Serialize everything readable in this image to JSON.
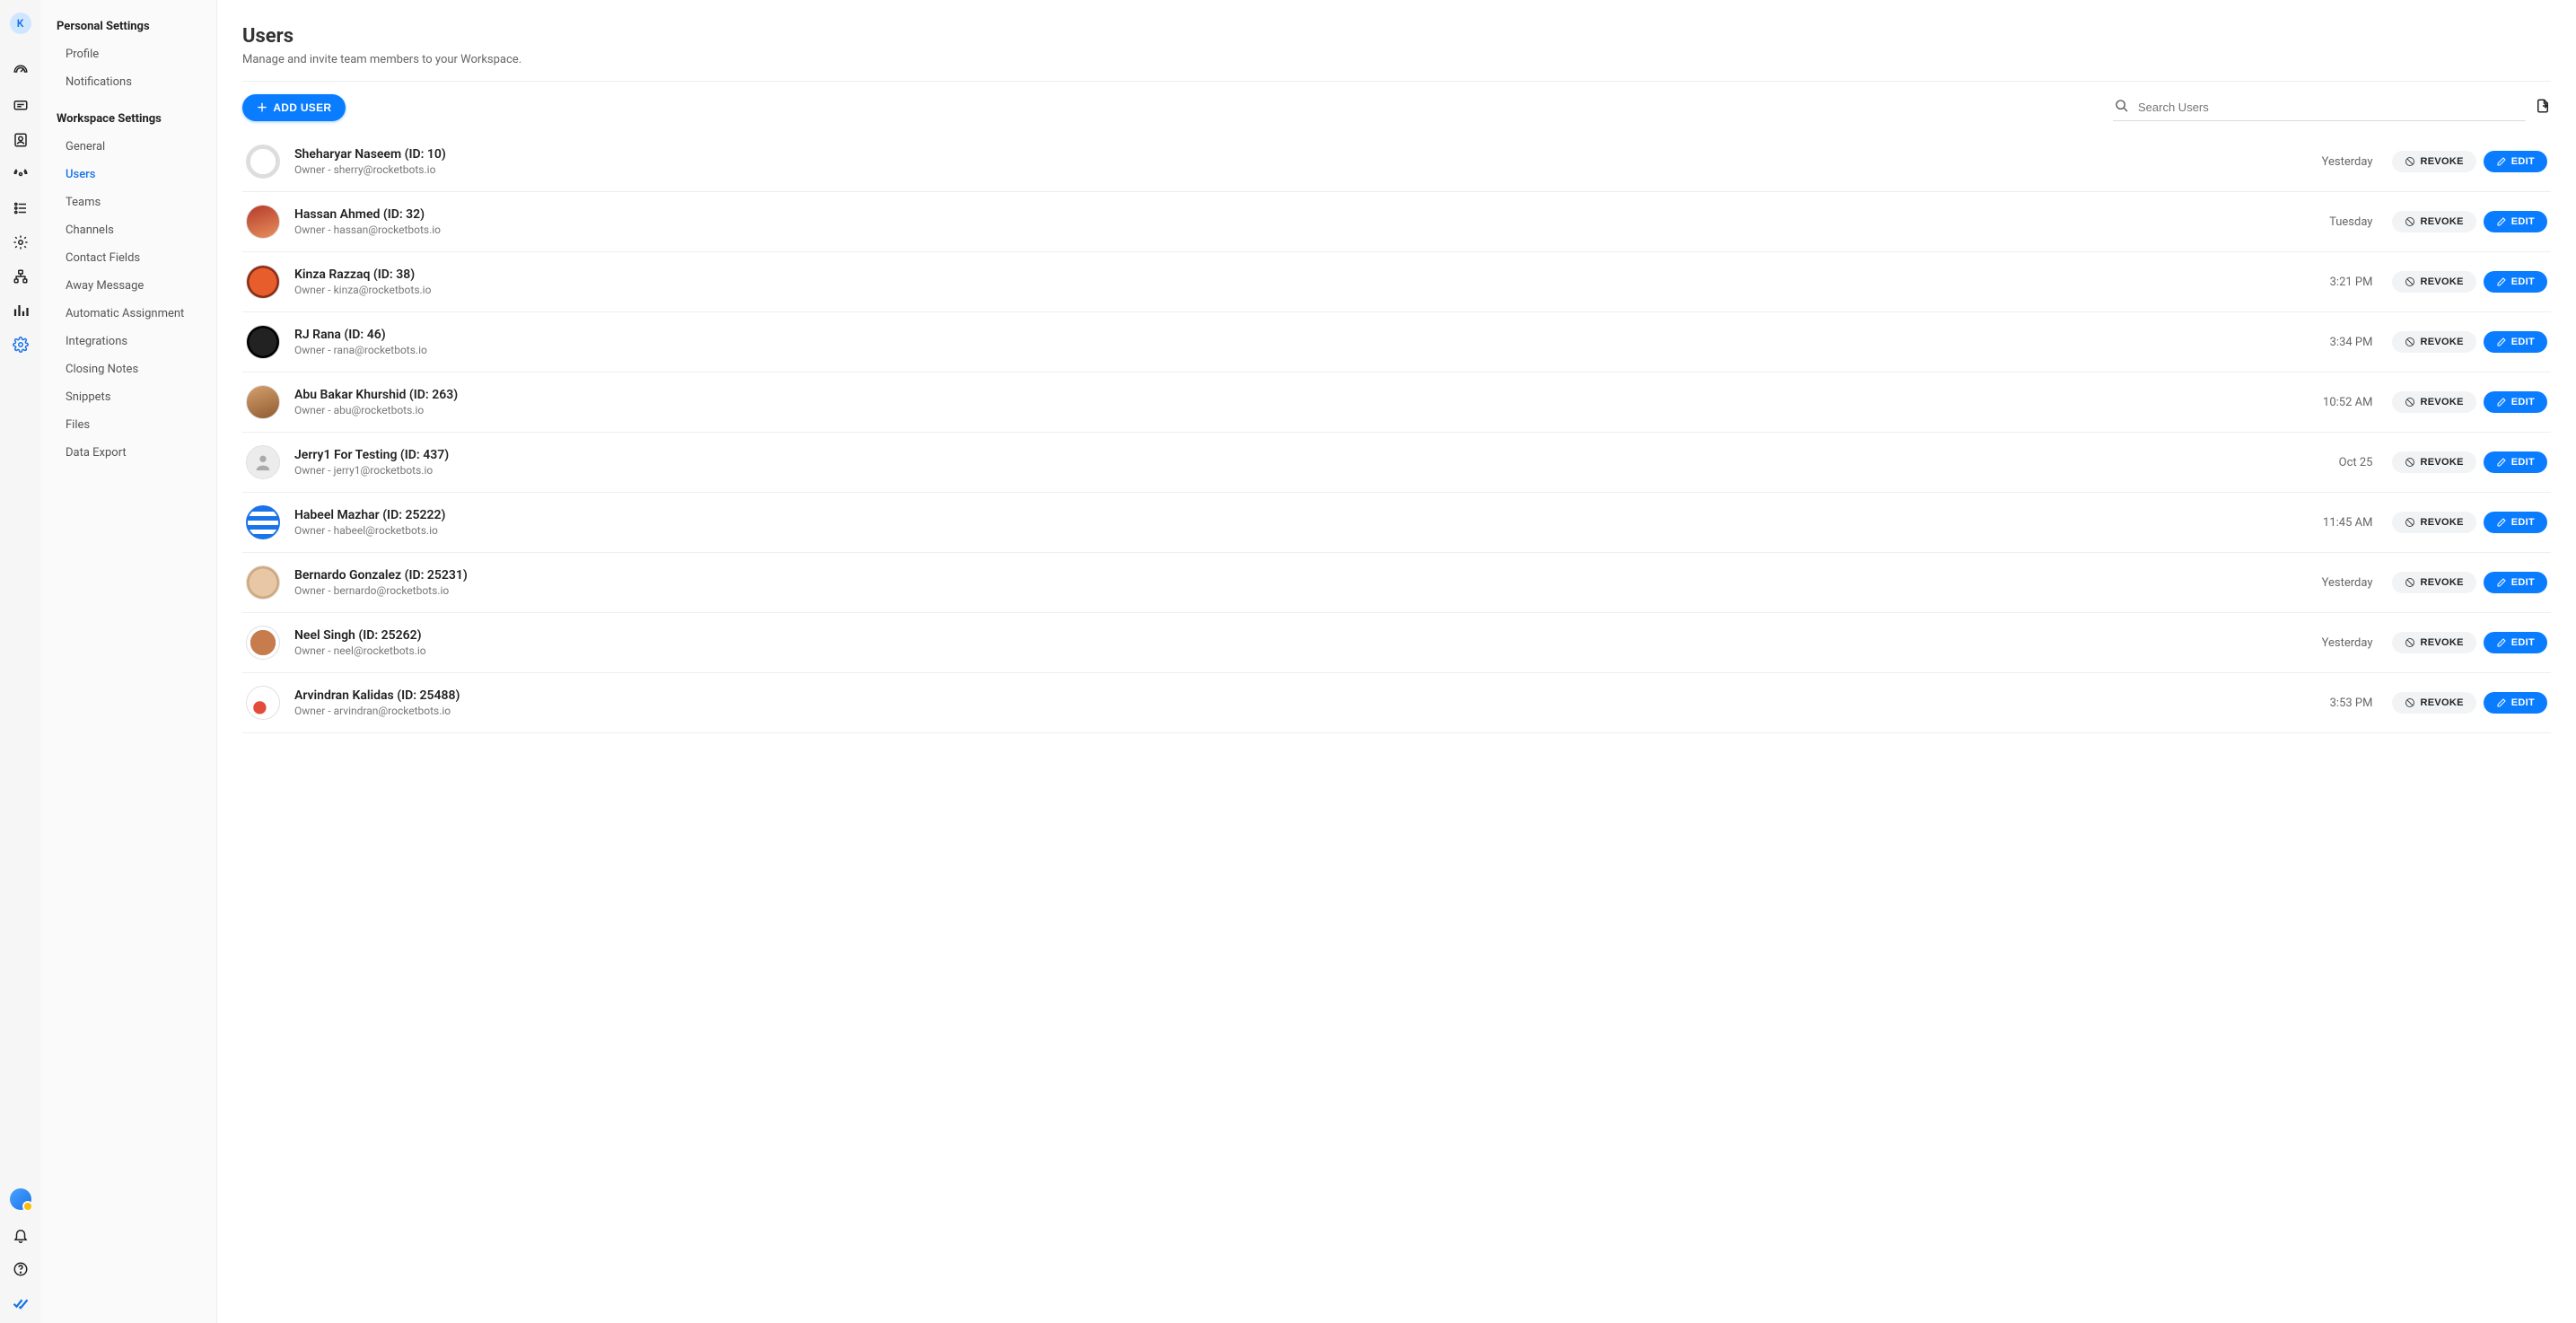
{
  "avatar_letter": "K",
  "settings_sidebar": {
    "group1_title": "Personal Settings",
    "group1_items": [
      "Profile",
      "Notifications"
    ],
    "group2_title": "Workspace Settings",
    "group2_items": [
      "General",
      "Users",
      "Teams",
      "Channels",
      "Contact Fields",
      "Away Message",
      "Automatic Assignment",
      "Integrations",
      "Closing Notes",
      "Snippets",
      "Files",
      "Data Export"
    ],
    "active_item": "Users"
  },
  "page": {
    "title": "Users",
    "subtitle": "Manage and invite team members to your Workspace."
  },
  "toolbar": {
    "add_label": "ADD USER",
    "search_placeholder": "Search Users"
  },
  "actions": {
    "revoke_label": "REVOKE",
    "edit_label": "EDIT"
  },
  "users": [
    {
      "name": "Sheharyar Naseem (ID: 10)",
      "meta": "Owner - sherry@rocketbots.io",
      "time": "Yesterday",
      "avatar_cls": "av-a"
    },
    {
      "name": "Hassan Ahmed (ID: 32)",
      "meta": "Owner - hassan@rocketbots.io",
      "time": "Tuesday",
      "avatar_cls": "av-b"
    },
    {
      "name": "Kinza Razzaq (ID: 38)",
      "meta": "Owner - kinza@rocketbots.io",
      "time": "3:21 PM",
      "avatar_cls": "av-c"
    },
    {
      "name": "RJ Rana (ID: 46)",
      "meta": "Owner - rana@rocketbots.io",
      "time": "3:34 PM",
      "avatar_cls": "av-d"
    },
    {
      "name": "Abu Bakar Khurshid (ID: 263)",
      "meta": "Owner - abu@rocketbots.io",
      "time": "10:52 AM",
      "avatar_cls": "av-e"
    },
    {
      "name": "Jerry1 For Testing (ID: 437)",
      "meta": "Owner - jerry1@rocketbots.io",
      "time": "Oct 25",
      "avatar_cls": "av-f"
    },
    {
      "name": "Habeel Mazhar (ID: 25222)",
      "meta": "Owner - habeel@rocketbots.io",
      "time": "11:45 AM",
      "avatar_cls": "av-g"
    },
    {
      "name": "Bernardo Gonzalez (ID: 25231)",
      "meta": "Owner - bernardo@rocketbots.io",
      "time": "Yesterday",
      "avatar_cls": "av-h"
    },
    {
      "name": "Neel Singh (ID: 25262)",
      "meta": "Owner - neel@rocketbots.io",
      "time": "Yesterday",
      "avatar_cls": "av-i"
    },
    {
      "name": "Arvindran Kalidas (ID: 25488)",
      "meta": "Owner - arvindran@rocketbots.io",
      "time": "3:53 PM",
      "avatar_cls": "av-j"
    }
  ]
}
